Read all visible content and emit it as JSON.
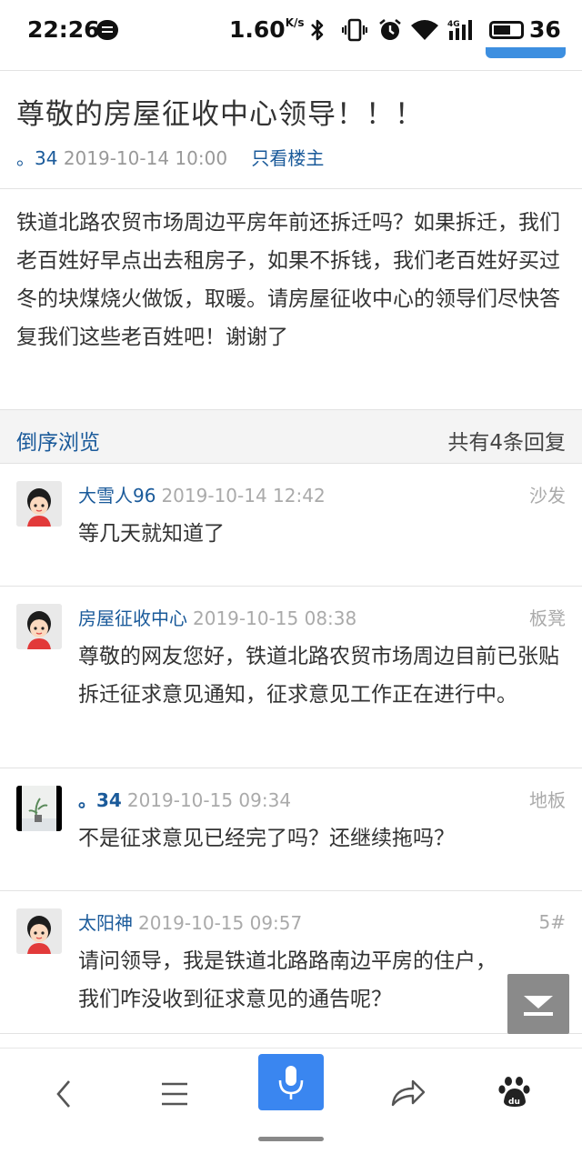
{
  "statusbar": {
    "time": "22:26",
    "speed": "1.60",
    "speed_unit": "K/s",
    "signal_label": "4G",
    "battery": "36",
    "icons": [
      "message-icon",
      "bluetooth-icon",
      "vibrate-icon",
      "alarm-icon",
      "wifi-icon",
      "signal-icon",
      "battery-icon"
    ]
  },
  "post": {
    "title": "尊敬的房屋征收中心领导！！！",
    "author": "。34",
    "datetime": "2019-10-14 10:00",
    "only_op_link": "只看楼主",
    "body": "铁道北路农贸市场周边平房年前还拆迁吗？如果拆迁，我们老百姓好早点出去租房子，如果不拆钱，我们老百姓好买过冬的块煤烧火做饭，取暖。请房屋征收中心的领导们尽快答复我们这些老百姓吧！谢谢了"
  },
  "order_bar": {
    "reverse_label": "倒序浏览",
    "reply_count_label": "共有4条回复"
  },
  "replies": [
    {
      "name": "大雪人96",
      "time": "2019-10-14 12:42",
      "floor": "沙发",
      "text": "等几天就知道了",
      "avatar": "cartoon-avatar"
    },
    {
      "name": "房屋征收中心",
      "time": "2019-10-15 08:38",
      "floor": "板凳",
      "text": "尊敬的网友您好，铁道北路农贸市场周边目前已张贴拆迁征求意见通知，征求意见工作正在进行中。",
      "avatar": "cartoon-avatar"
    },
    {
      "name": "。34",
      "time": "2019-10-15 09:34",
      "floor": "地板",
      "text": "不是征求意见已经完了吗？还继续拖吗？",
      "avatar": "photo-avatar"
    },
    {
      "name": "太阳神",
      "time": "2019-10-15 09:57",
      "floor": "5#",
      "text": "请问领导，我是铁道北路路南边平房的住户，我们咋没收到征求意见的通告呢？",
      "avatar": "cartoon-avatar"
    }
  ],
  "bottom_nav": {
    "items": [
      "back-icon",
      "menu-icon",
      "microphone-icon",
      "share-icon",
      "baidu-paw-icon"
    ],
    "baidu_label": "du"
  },
  "colors": {
    "link_blue": "#1a5a9a",
    "mic_blue": "#3a86f0",
    "gray_text": "#999999"
  }
}
